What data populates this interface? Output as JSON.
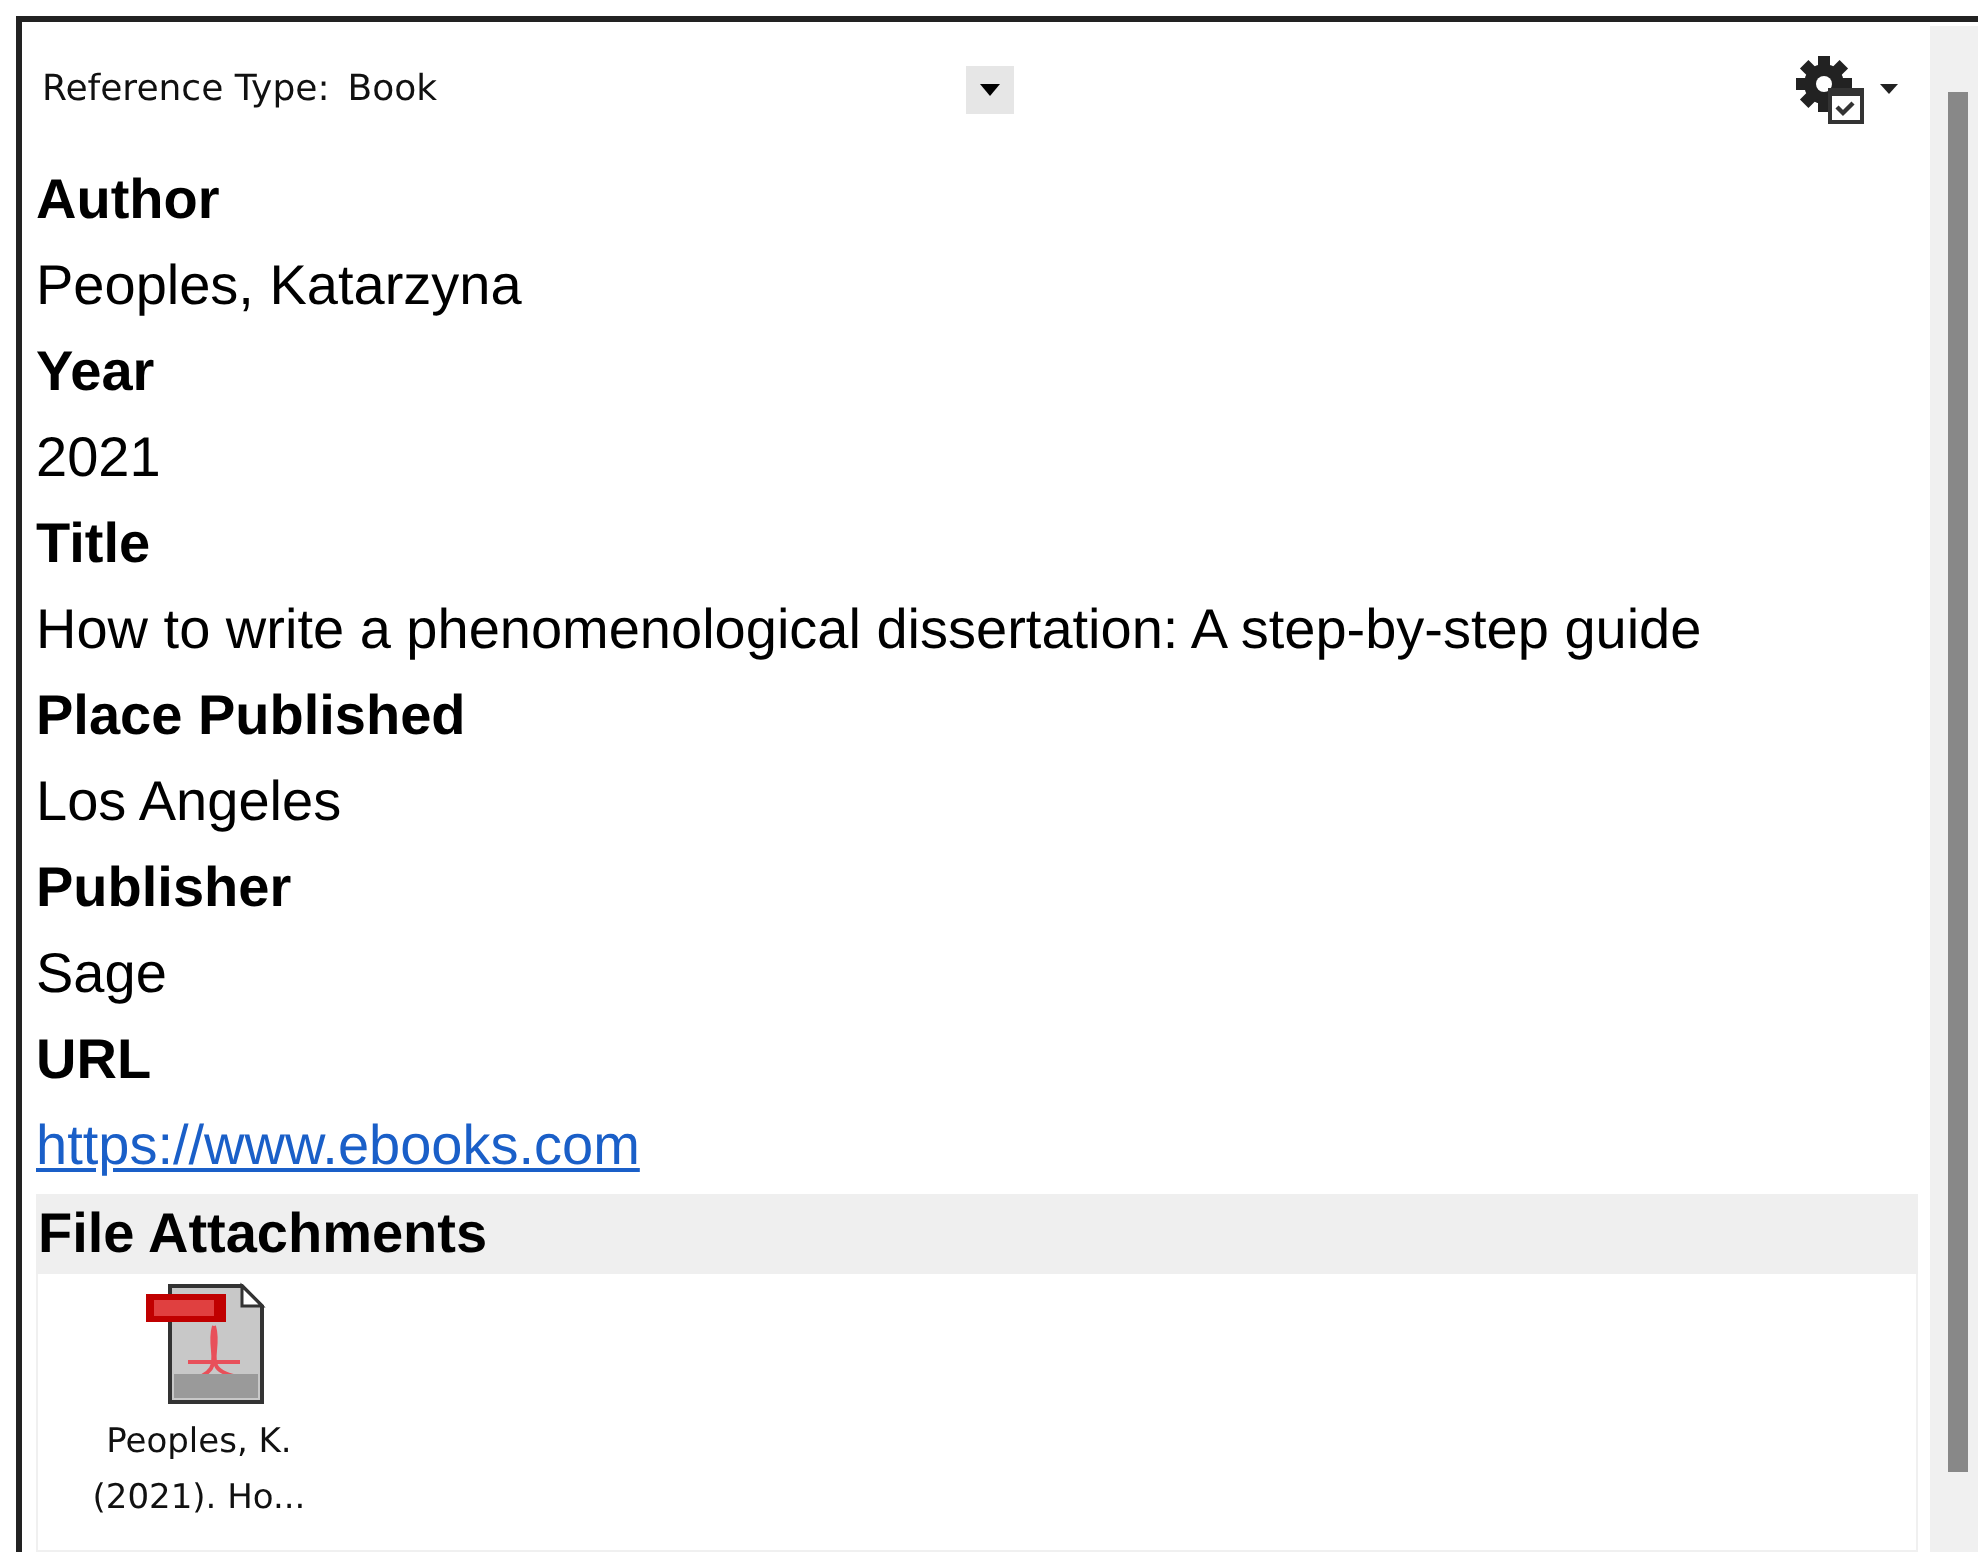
{
  "reference_type": {
    "label": "Reference Type:",
    "value": "Book"
  },
  "fields": [
    {
      "label": "Author",
      "value": "Peoples, Katarzyna",
      "kind": "text"
    },
    {
      "label": "Year",
      "value": "2021",
      "kind": "text"
    },
    {
      "label": "Title",
      "value": "How to write a phenomenological dissertation: A step-by-step guide",
      "kind": "text"
    },
    {
      "label": "Place Published",
      "value": "Los Angeles",
      "kind": "text"
    },
    {
      "label": "Publisher",
      "value": "Sage",
      "kind": "text"
    },
    {
      "label": "URL",
      "value": "https://www.ebooks.com",
      "kind": "link"
    }
  ],
  "attachments": {
    "heading": "File Attachments",
    "files": [
      {
        "name": "Peoples, K. (2021). Ho...",
        "kind": "pdf"
      }
    ]
  }
}
